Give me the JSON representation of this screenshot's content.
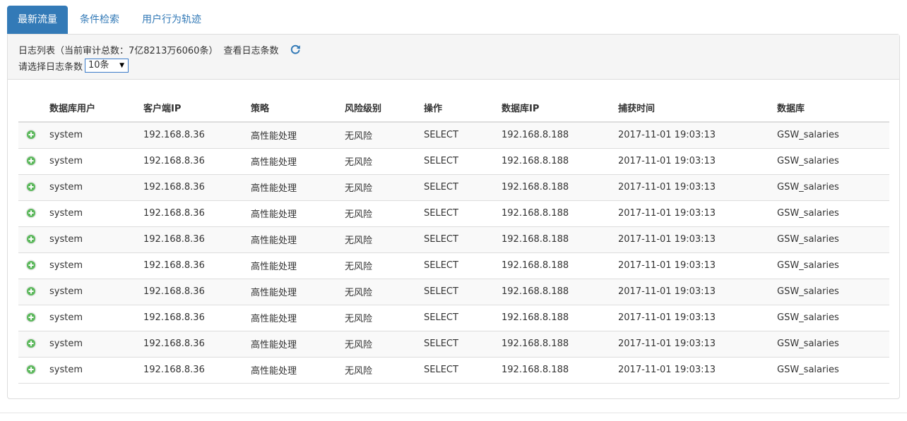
{
  "tabs": [
    {
      "label": "最新流量",
      "active": true
    },
    {
      "label": "条件检索",
      "active": false
    },
    {
      "label": "用户行为轨迹",
      "active": false
    }
  ],
  "panel": {
    "log_title": "日志列表（当前审计总数：7亿8213万6060条）",
    "view_count_label": "查看日志条数",
    "select_label": "请选择日志条数",
    "select_value": "10条",
    "refresh_icon": "refresh-icon"
  },
  "table": {
    "columns": [
      "数据库用户",
      "客户端IP",
      "策略",
      "风险级别",
      "操作",
      "数据库IP",
      "捕获时间",
      "数据库"
    ],
    "rows": [
      [
        "system",
        "192.168.8.36",
        "高性能处理",
        "无风险",
        "SELECT",
        "192.168.8.188",
        "2017-11-01 19:03:13",
        "GSW_salaries"
      ],
      [
        "system",
        "192.168.8.36",
        "高性能处理",
        "无风险",
        "SELECT",
        "192.168.8.188",
        "2017-11-01 19:03:13",
        "GSW_salaries"
      ],
      [
        "system",
        "192.168.8.36",
        "高性能处理",
        "无风险",
        "SELECT",
        "192.168.8.188",
        "2017-11-01 19:03:13",
        "GSW_salaries"
      ],
      [
        "system",
        "192.168.8.36",
        "高性能处理",
        "无风险",
        "SELECT",
        "192.168.8.188",
        "2017-11-01 19:03:13",
        "GSW_salaries"
      ],
      [
        "system",
        "192.168.8.36",
        "高性能处理",
        "无风险",
        "SELECT",
        "192.168.8.188",
        "2017-11-01 19:03:13",
        "GSW_salaries"
      ],
      [
        "system",
        "192.168.8.36",
        "高性能处理",
        "无风险",
        "SELECT",
        "192.168.8.188",
        "2017-11-01 19:03:13",
        "GSW_salaries"
      ],
      [
        "system",
        "192.168.8.36",
        "高性能处理",
        "无风险",
        "SELECT",
        "192.168.8.188",
        "2017-11-01 19:03:13",
        "GSW_salaries"
      ],
      [
        "system",
        "192.168.8.36",
        "高性能处理",
        "无风险",
        "SELECT",
        "192.168.8.188",
        "2017-11-01 19:03:13",
        "GSW_salaries"
      ],
      [
        "system",
        "192.168.8.36",
        "高性能处理",
        "无风险",
        "SELECT",
        "192.168.8.188",
        "2017-11-01 19:03:13",
        "GSW_salaries"
      ],
      [
        "system",
        "192.168.8.36",
        "高性能处理",
        "无风险",
        "SELECT",
        "192.168.8.188",
        "2017-11-01 19:03:13",
        "GSW_salaries"
      ]
    ],
    "row_icon": "expand-plus-icon"
  },
  "colors": {
    "accent": "#337ab7",
    "expand_icon": "#5cb85c",
    "panel_heading_bg": "#f5f5f5",
    "border": "#dddddd"
  }
}
